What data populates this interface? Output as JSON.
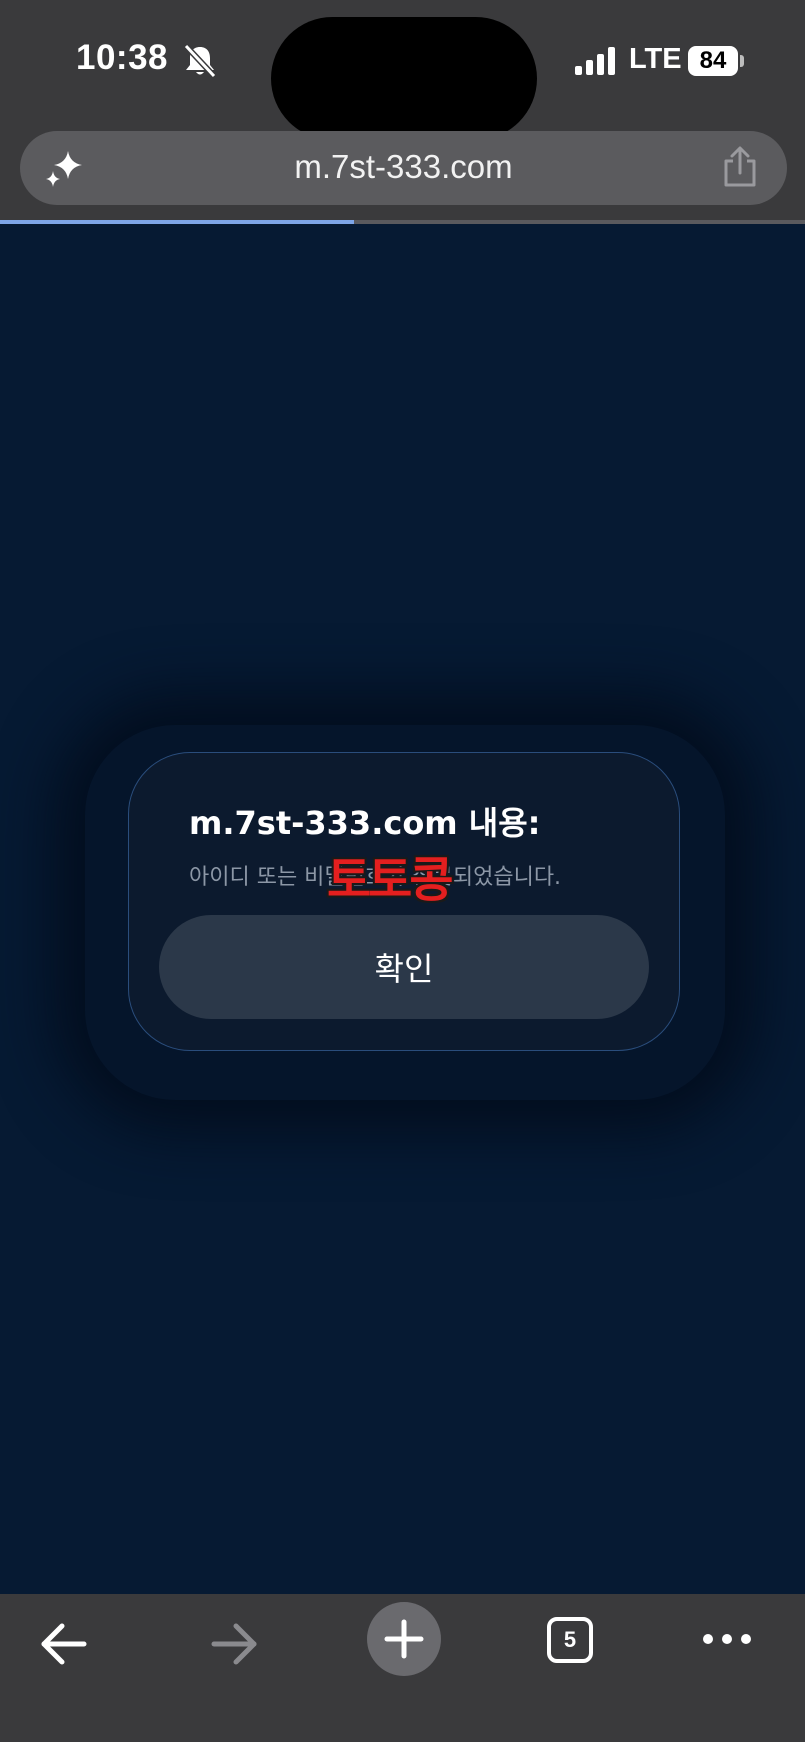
{
  "status_bar": {
    "time": "10:38",
    "network": "LTE",
    "battery": "84"
  },
  "browser": {
    "url": "m.7st-333.com",
    "load_progress": 0.44,
    "tab_count": "5"
  },
  "dialog": {
    "title": "m.7st-333.com 내용:",
    "message": "아이디 또는 비밀번호가 잘못되었습니다.",
    "confirm_label": "확인",
    "watermark": "토토콩"
  },
  "icons": {
    "bell": "bell-slash-icon",
    "signal": "cellular-signal-icon",
    "sparkle": "sparkle-icon",
    "share": "share-icon",
    "back": "arrow-left-icon",
    "forward": "arrow-right-icon",
    "new_tab": "plus-icon",
    "more": "ellipsis-icon"
  },
  "colors": {
    "page_background": "#061a33",
    "chrome_background": "#3a3a3c",
    "progress": "#7ea6e8",
    "watermark": "#e41f1f"
  }
}
